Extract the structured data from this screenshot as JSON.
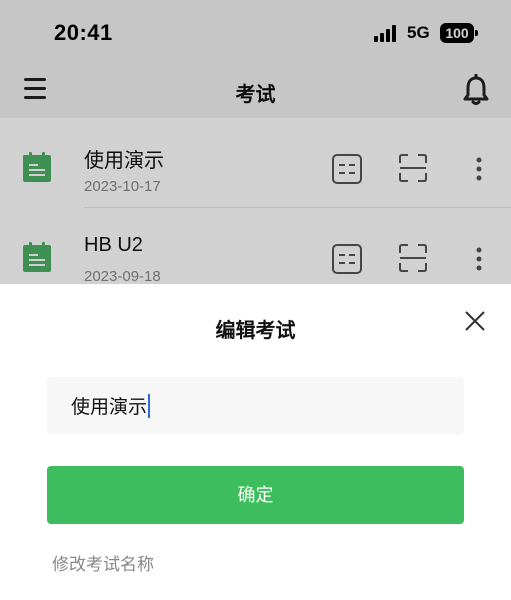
{
  "status_bar": {
    "time": "20:41",
    "network": "5G",
    "battery": "100"
  },
  "navbar": {
    "title": "考试",
    "menu_icon": "hamburger-menu-icon",
    "bell_icon": "bell-icon"
  },
  "exams": [
    {
      "name": "使用演示",
      "date": "2023-10-17"
    },
    {
      "name": "HB U2",
      "date": "2023-09-18"
    }
  ],
  "sheet": {
    "title": "编辑考试",
    "input_value": "使用演示",
    "confirm_label": "确定",
    "hint": "修改考试名称"
  },
  "colors": {
    "accent_green": "#3dbd5d",
    "icon_green": "#4caf65",
    "caret_blue": "#2b6bd6"
  }
}
